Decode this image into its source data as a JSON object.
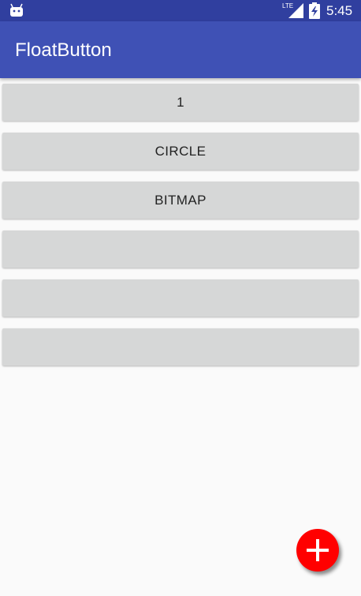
{
  "status_bar": {
    "time": "5:45",
    "network_label": "LTE",
    "icons": [
      "android-icon",
      "lte-signal-icon",
      "battery-charging-icon"
    ]
  },
  "app_bar": {
    "title": "FloatButton"
  },
  "buttons": [
    {
      "label": "1"
    },
    {
      "label": "CIRCLE"
    },
    {
      "label": "BITMAP"
    },
    {
      "label": ""
    },
    {
      "label": ""
    },
    {
      "label": ""
    }
  ],
  "fab": {
    "icon": "plus-icon",
    "color": "#ff0000"
  },
  "colors": {
    "status_bar": "#303f9f",
    "app_bar": "#3f51b5",
    "button_bg": "#d6d7d7",
    "background": "#fafafa"
  }
}
